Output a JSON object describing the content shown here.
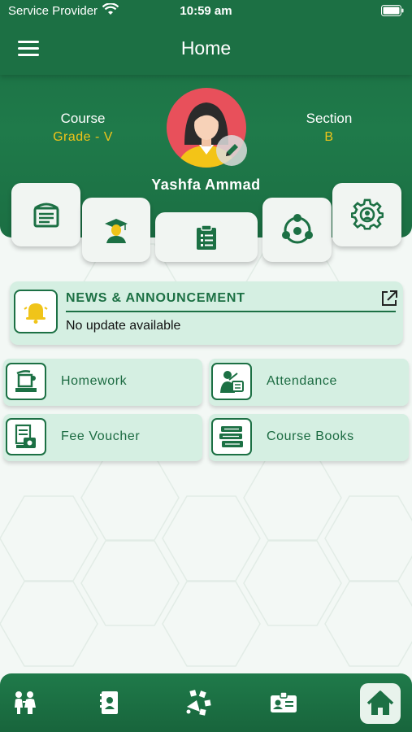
{
  "status_bar": {
    "carrier": "Service Provider",
    "time": "10:59 am"
  },
  "header": {
    "title": "Home",
    "menu_icon": "hamburger-menu-icon"
  },
  "profile": {
    "course_label": "Course",
    "course_value": "Grade - V",
    "section_label": "Section",
    "section_value": "B",
    "name": "Yashfa Ammad"
  },
  "quick_tiles": [
    {
      "icon": "classroom-board-icon"
    },
    {
      "icon": "graduate-icon"
    },
    {
      "icon": "report-document-icon"
    },
    {
      "icon": "group-network-icon"
    },
    {
      "icon": "settings-gear-icon"
    }
  ],
  "news": {
    "title": "NEWS & ANNOUNCEMENT",
    "body": "No update available",
    "icon": "bell-icon"
  },
  "features": [
    {
      "label": "Homework",
      "icon": "homework-icon"
    },
    {
      "label": "Attendance",
      "icon": "attendance-icon"
    },
    {
      "label": "Fee Voucher",
      "icon": "fee-voucher-icon"
    },
    {
      "label": "Course Books",
      "icon": "books-icon"
    }
  ],
  "bottom_nav": [
    {
      "icon": "family-icon"
    },
    {
      "icon": "contact-book-icon"
    },
    {
      "icon": "activities-icon"
    },
    {
      "icon": "id-card-icon"
    },
    {
      "icon": "home-icon",
      "active": true
    }
  ],
  "colors": {
    "primary": "#1c7044",
    "accent": "#f0c419",
    "card": "#d5efe2",
    "avatar_bg": "#e8505b"
  }
}
